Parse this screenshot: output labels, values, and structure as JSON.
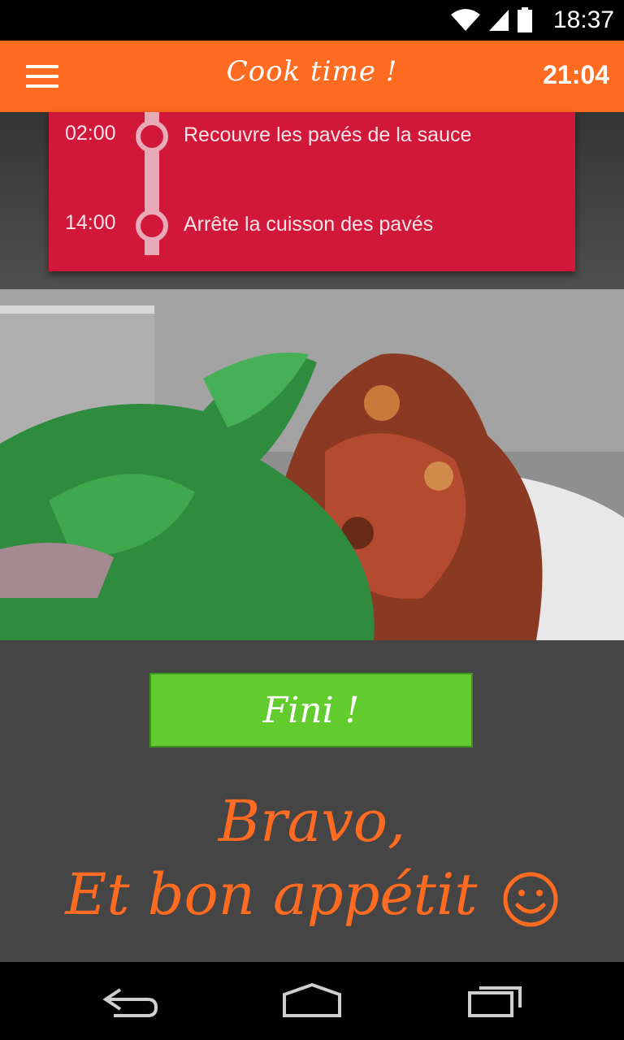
{
  "status_bar": {
    "time": "18:37",
    "icons": [
      "wifi-icon",
      "signal-icon",
      "battery-icon"
    ]
  },
  "app_bar": {
    "title": "Cook time !",
    "timer": "21:04",
    "menu_icon": "menu-icon"
  },
  "steps": [
    {
      "time": "02:00",
      "text": "Recouvre les pavés de la sauce"
    },
    {
      "time": "14:00",
      "text": "Arrête la cuisson des pavés"
    }
  ],
  "photo": {
    "description_icon": "dish-photo"
  },
  "done_button": {
    "label": "Fini !"
  },
  "message": {
    "line1": "Bravo,",
    "line2": "Et bon appétit"
  },
  "nav": {
    "back_icon": "back-icon",
    "home_icon": "home-icon",
    "recents_icon": "recents-icon"
  },
  "colors": {
    "accent": "#ff6b21",
    "card": "#d2183a",
    "button": "#62cc2f",
    "background": "#454545"
  }
}
